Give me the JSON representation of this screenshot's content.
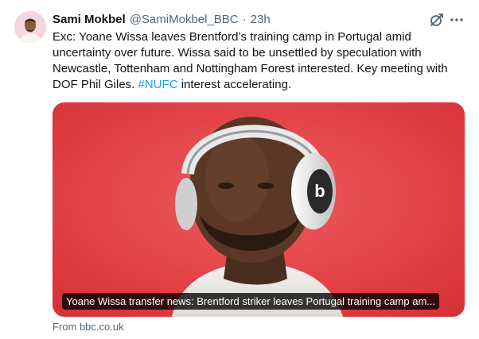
{
  "tweet": {
    "author_name": "Sami Mokbel",
    "author_handle": "@SamiMokbel_BBC",
    "separator": "·",
    "timestamp": "23h",
    "text_before_hashtag": "Exc: Yoane Wissa leaves Brentford’s training camp in Portugal amid uncertainty over future. Wissa said to be unsettled by speculation with Newcastle, Tottenham and Nottingham Forest interested. Key meeting with DOF Phil Giles. ",
    "hashtag": "#NUFC",
    "text_after_hashtag": " interest accelerating."
  },
  "link_card": {
    "title": "Yoane Wissa transfer news: Brentford striker leaves Portugal training camp am...",
    "source": "From bbc.co.uk"
  },
  "icons": {
    "grok": "grok-icon",
    "more": "more-icon",
    "headphones_logo": "b"
  },
  "colors": {
    "hashtag": "#1d9bf0",
    "secondary_text": "#536471",
    "card_background": "#e4393c"
  }
}
